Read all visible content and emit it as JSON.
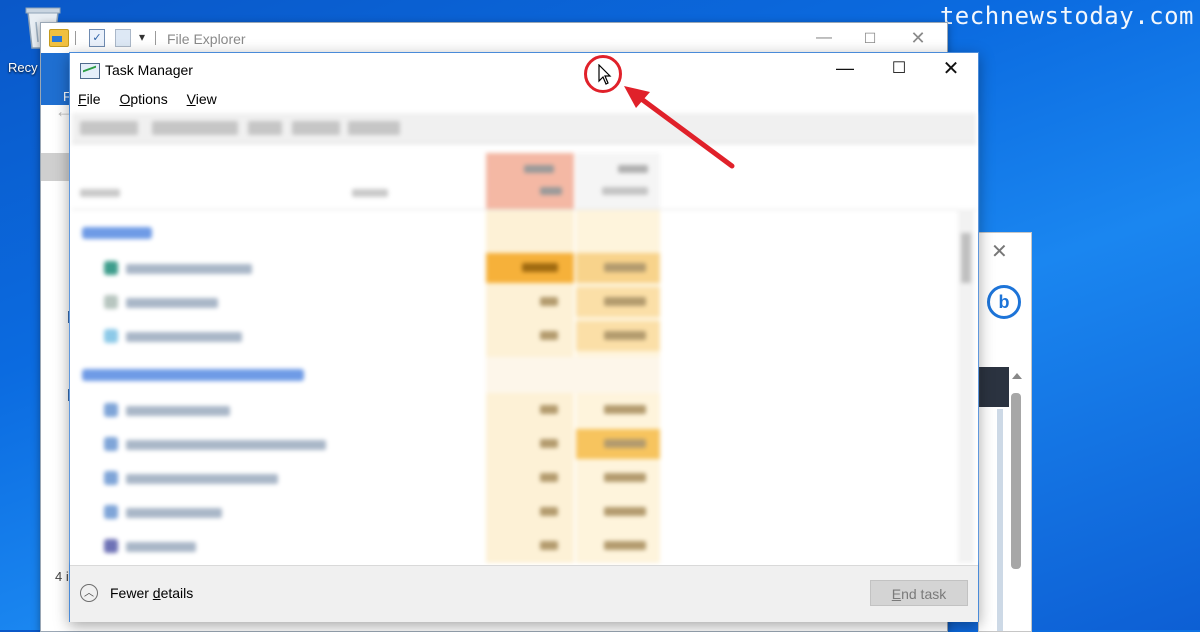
{
  "watermark": "technewstoday.com",
  "desktop": {
    "recycle_bin_label": "Recy"
  },
  "file_explorer": {
    "title": "File Explorer",
    "ribbon_tab": "F",
    "status_text": "4 i",
    "controls": {
      "minimize": "—",
      "maximize": "☐",
      "close": "✕"
    }
  },
  "side_panel": {
    "close": "✕",
    "bing_glyph": "b"
  },
  "task_manager": {
    "title": "Task Manager",
    "controls": {
      "minimize": "—",
      "maximize": "☐",
      "close": "✕"
    },
    "menu": {
      "file_u": "F",
      "file_rest": "ile",
      "options_u": "O",
      "options_rest": "ptions",
      "view_u": "V",
      "view_rest": "iew"
    },
    "footer": {
      "fewer_details_pre": "Fewer ",
      "fewer_details_u": "d",
      "fewer_details_post": "etails",
      "end_task_u": "E",
      "end_task_rest": "nd task"
    }
  },
  "colors": {
    "annotation": "#e0212a",
    "desktop_blue": "#0b6be0",
    "cpu_header": "#f4b8a4"
  }
}
